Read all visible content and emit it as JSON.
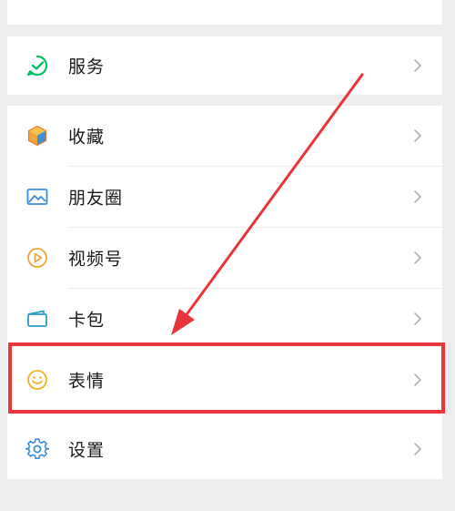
{
  "menu": {
    "services": {
      "label": "服务",
      "icon": "wechat-pay-check-icon"
    },
    "items": [
      {
        "label": "收藏",
        "icon": "favorites-cube-icon"
      },
      {
        "label": "朋友圈",
        "icon": "moments-picture-icon"
      },
      {
        "label": "视频号",
        "icon": "channels-play-icon"
      },
      {
        "label": "卡包",
        "icon": "card-wallet-icon"
      },
      {
        "label": "表情",
        "icon": "sticker-smiley-icon"
      },
      {
        "label": "设置",
        "icon": "settings-gear-icon"
      }
    ]
  },
  "annotation": {
    "highlighted_item": "表情",
    "highlight_color": "#e8343b"
  },
  "colors": {
    "background": "#ededed",
    "card": "#ffffff",
    "text": "#191919",
    "chevron": "#b2b2b2",
    "services_green": "#07c160",
    "favorites_orange": "#f2a33a",
    "moments_blue": "#3d8fd8",
    "channels_orange": "#f2a33a",
    "card_teal": "#2a9cc8",
    "sticker_yellow": "#f0b429",
    "settings_blue": "#3d8fd8"
  }
}
